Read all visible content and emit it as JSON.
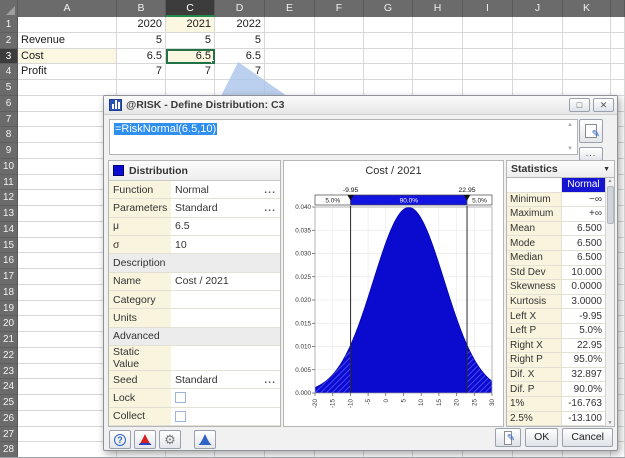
{
  "spreadsheet": {
    "columns": [
      "A",
      "B",
      "C",
      "D",
      "E",
      "F",
      "G",
      "H",
      "I",
      "J",
      "K"
    ],
    "num_rows": 28,
    "selected_cell": "C3",
    "selected_column": "C",
    "selected_row": 3,
    "highlight_color": "#fcf7e1",
    "selection_color": "#217346",
    "cells": [
      {
        "r": 1,
        "c": "B",
        "v": "2020"
      },
      {
        "r": 1,
        "c": "C",
        "v": "2021",
        "hl": true
      },
      {
        "r": 1,
        "c": "D",
        "v": "2022"
      },
      {
        "r": 2,
        "c": "A",
        "v": "Revenue",
        "align": "left"
      },
      {
        "r": 2,
        "c": "B",
        "v": "5"
      },
      {
        "r": 2,
        "c": "C",
        "v": "5"
      },
      {
        "r": 2,
        "c": "D",
        "v": "5"
      },
      {
        "r": 3,
        "c": "A",
        "v": "Cost",
        "align": "left",
        "hl": true
      },
      {
        "r": 3,
        "c": "B",
        "v": "6.5"
      },
      {
        "r": 3,
        "c": "C",
        "v": "6.5",
        "hl": true,
        "selected": true
      },
      {
        "r": 3,
        "c": "D",
        "v": "6.5"
      },
      {
        "r": 4,
        "c": "A",
        "v": "Profit",
        "align": "left"
      },
      {
        "r": 4,
        "c": "B",
        "v": "7"
      },
      {
        "r": 4,
        "c": "C",
        "v": "7"
      },
      {
        "r": 4,
        "c": "D",
        "v": "7"
      }
    ]
  },
  "dialog": {
    "title": "@RISK - Define Distribution: C3",
    "formula": "=RiskNormal(6.5,10)",
    "window_buttons": {
      "maximize": "□",
      "close": "✕"
    },
    "more_glyph": "...",
    "properties": {
      "header": "Distribution",
      "rows": [
        {
          "label": "Function",
          "value": "Normal",
          "more": true
        },
        {
          "label": "Parameters",
          "value": "Standard",
          "more": true
        },
        {
          "label": "μ",
          "value": "6.5"
        },
        {
          "label": "σ",
          "value": "10"
        },
        {
          "section": "Description"
        },
        {
          "label": "Name",
          "value": "Cost / 2021"
        },
        {
          "label": "Category",
          "value": ""
        },
        {
          "label": "Units",
          "value": ""
        },
        {
          "section": "Advanced"
        },
        {
          "label": "Static Value",
          "value": ""
        },
        {
          "label": "Seed",
          "value": "Standard",
          "more": true
        },
        {
          "label": "Lock",
          "checkbox": true
        },
        {
          "label": "Collect",
          "checkbox": true
        }
      ]
    },
    "statistics": {
      "header": "Statistics",
      "column": "Normal",
      "rows": [
        [
          "Minimum",
          "−∞"
        ],
        [
          "Maximum",
          "+∞"
        ],
        [
          "Mean",
          "6.500"
        ],
        [
          "Mode",
          "6.500"
        ],
        [
          "Median",
          "6.500"
        ],
        [
          "Std Dev",
          "10.000"
        ],
        [
          "Skewness",
          "0.0000"
        ],
        [
          "Kurtosis",
          "3.0000"
        ],
        [
          "Left X",
          "-9.95"
        ],
        [
          "Left P",
          "5.0%"
        ],
        [
          "Right X",
          "22.95"
        ],
        [
          "Right P",
          "95.0%"
        ],
        [
          "Dif. X",
          "32.897"
        ],
        [
          "Dif. P",
          "90.0%"
        ],
        [
          "1%",
          "-16.763"
        ],
        [
          "2.5%",
          "-13.100"
        ]
      ]
    },
    "buttons": {
      "ok": "OK",
      "cancel": "Cancel"
    },
    "icons": {
      "app-icon": "blue histogram bars",
      "help-icon": "?",
      "define-distribution-red-icon": "red bell curve",
      "settings-gear-icon": "⚙",
      "define-distribution-blue-icon": "blue bell curve",
      "edit-pencil-icon": "✎",
      "dropdown-icon": "▼"
    }
  },
  "chart_data": {
    "type": "area",
    "title": "Cost / 2021",
    "distribution": "RiskNormal",
    "parameters": {
      "mu": 6.5,
      "sigma": 10
    },
    "xlim": [
      -20,
      30
    ],
    "ylim": [
      0,
      0.04
    ],
    "x_ticks": [
      -20,
      -15,
      -10,
      -5,
      0,
      5,
      10,
      15,
      20,
      25,
      30
    ],
    "y_ticks": [
      "0.000",
      "0.005",
      "0.010",
      "0.015",
      "0.020",
      "0.025",
      "0.030",
      "0.035",
      "0.040"
    ],
    "delimiters": {
      "left_x": -9.95,
      "right_x": 22.95,
      "left_label": "-9.95",
      "right_label": "22.95",
      "left_pct": "5.0%",
      "mid_pct": "90.0%",
      "right_pct": "5.0%"
    },
    "curve_color": "#0b0bd0",
    "grid": true,
    "legend": "none"
  }
}
